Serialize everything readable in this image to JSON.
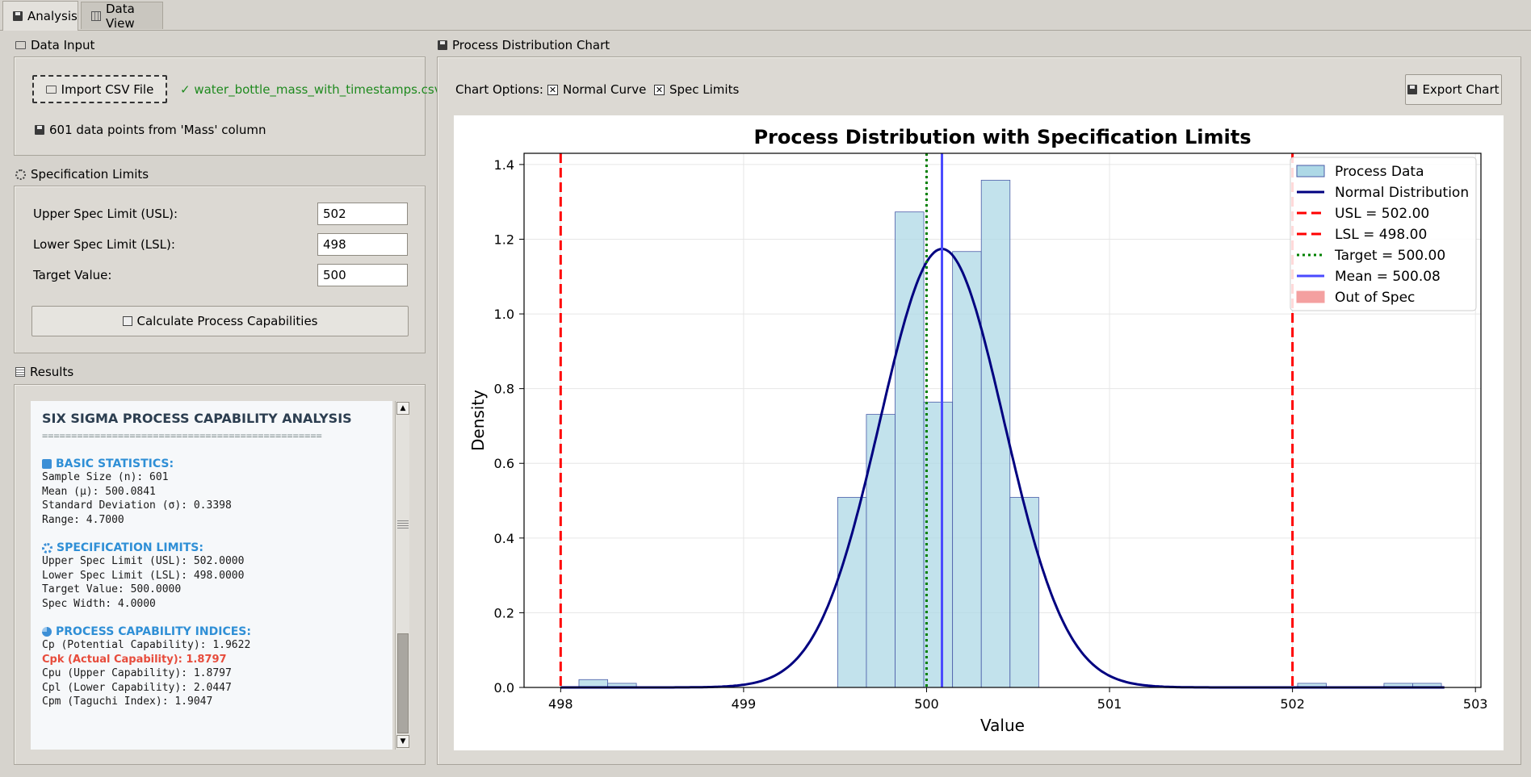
{
  "tabs": [
    {
      "label": "Analysis",
      "icon": "chart-icon",
      "active": true
    },
    {
      "label": "Data View",
      "icon": "table-icon",
      "active": false
    }
  ],
  "data_input": {
    "title": "Data Input",
    "import_button": "Import CSV File",
    "file_status": "✓ water_bottle_mass_with_timestamps.csv",
    "points_note": "601 data points from 'Mass' column"
  },
  "spec_limits": {
    "title": "Specification Limits",
    "usl_label": "Upper Spec Limit (USL):",
    "usl_value": "502",
    "lsl_label": "Lower Spec Limit (LSL):",
    "lsl_value": "498",
    "target_label": "Target Value:",
    "target_value": "500",
    "calc_button": "Calculate Process Capabilities"
  },
  "results": {
    "title": "Results",
    "heading": "SIX SIGMA PROCESS CAPABILITY ANALYSIS",
    "rule": "================================================",
    "basic_head": "BASIC STATISTICS:",
    "basic_lines": [
      "Sample Size (n): 601",
      "Mean (μ): 500.0841",
      "Standard Deviation (σ): 0.3398",
      "Range: 4.7000"
    ],
    "spec_head": "SPECIFICATION LIMITS:",
    "spec_lines": [
      "Upper Spec Limit (USL): 502.0000",
      "Lower Spec Limit (LSL): 498.0000",
      "Target Value: 500.0000",
      "Spec Width: 4.0000"
    ],
    "cap_head": "PROCESS CAPABILITY INDICES:",
    "cap_line_cp": "Cp (Potential Capability): 1.9622",
    "cap_line_cpk": "Cpk (Actual Capability): 1.8797",
    "cap_lines_rest": [
      "Cpu (Upper Capability): 1.8797",
      "Cpl (Lower Capability): 2.0447",
      "Cpm (Taguchi Index): 1.9047"
    ],
    "highlight_color": "#e74c3c",
    "heading_color": "#2f8fd6"
  },
  "chart_panel": {
    "title": "Process Distribution Chart",
    "options_label": "Chart Options:",
    "normal_curve_label": "Normal Curve",
    "normal_curve_checked": true,
    "spec_limits_label": "Spec Limits",
    "spec_limits_checked": true,
    "export_button": "Export Chart"
  },
  "chart_data": {
    "type": "bar",
    "title": "Process Distribution with Specification Limits",
    "xlabel": "Value",
    "ylabel": "Density",
    "xlim": [
      497.8,
      503.03
    ],
    "ylim": [
      0,
      1.43
    ],
    "xticks": [
      498,
      499,
      500,
      501,
      502,
      503
    ],
    "yticks": [
      0.0,
      0.2,
      0.4,
      0.6,
      0.8,
      1.0,
      1.2,
      1.4
    ],
    "grid": true,
    "legend_position": "top-right",
    "histogram": {
      "name": "Process Data",
      "bin_width": 0.157,
      "bins": [
        {
          "x0": 498.1,
          "value": 0.021
        },
        {
          "x0": 498.257,
          "value": 0.011
        },
        {
          "x0": 499.514,
          "value": 0.509
        },
        {
          "x0": 499.671,
          "value": 0.731
        },
        {
          "x0": 499.828,
          "value": 1.273
        },
        {
          "x0": 499.985,
          "value": 0.764
        },
        {
          "x0": 500.142,
          "value": 1.167
        },
        {
          "x0": 500.299,
          "value": 1.358
        },
        {
          "x0": 500.456,
          "value": 0.509
        },
        {
          "x0": 502.028,
          "value": 0.011
        },
        {
          "x0": 502.5,
          "value": 0.011
        },
        {
          "x0": 502.657,
          "value": 0.011
        }
      ],
      "fill": "#add8e6",
      "edge": "#4a5ca8"
    },
    "normal_curve": {
      "name": "Normal Distribution",
      "mean": 500.0841,
      "std": 0.3398,
      "color": "#000080"
    },
    "lines": [
      {
        "name": "USL = 502.00",
        "x": 502.0,
        "style": "dashed",
        "color": "#ff0000"
      },
      {
        "name": "LSL = 498.00",
        "x": 498.0,
        "style": "dashed",
        "color": "#ff0000"
      },
      {
        "name": "Target = 500.00",
        "x": 500.0,
        "style": "dotted",
        "color": "#008000"
      },
      {
        "name": "Mean = 500.08",
        "x": 500.0841,
        "style": "solid",
        "color": "#4a4aff"
      }
    ],
    "out_of_spec": {
      "name": "Out of Spec",
      "color": "#f4a0a0"
    }
  }
}
